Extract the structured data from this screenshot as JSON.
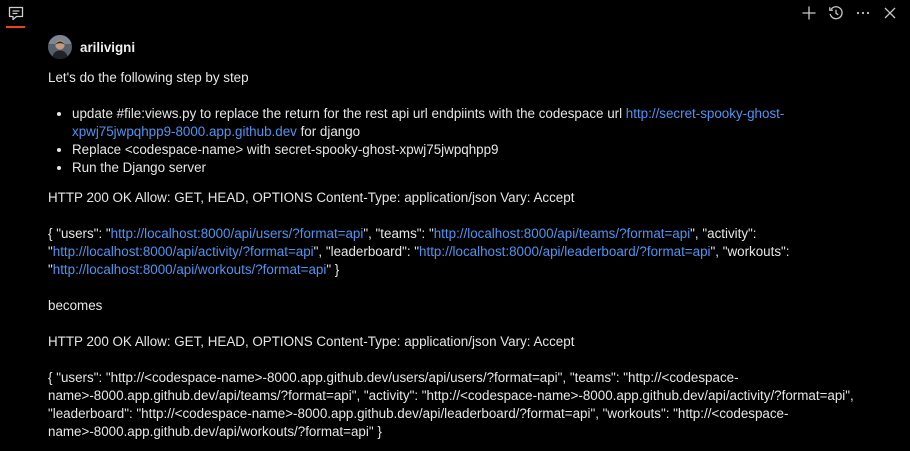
{
  "colors": {
    "background": "#000000",
    "text": "#e6e6e6",
    "link": "#4e94f0",
    "accent": "#e8412f"
  },
  "toolbar": {
    "tab_icon": "chat-icon",
    "actions": [
      {
        "icon": "plus-icon"
      },
      {
        "icon": "history-icon"
      },
      {
        "icon": "more-icon"
      },
      {
        "icon": "close-icon"
      }
    ]
  },
  "message": {
    "username": "arilivigni",
    "intro": "Let's do the following step by step",
    "bullet1_pre": "update #file:views.py to replace the return for the rest api url endpiints with the codespace url ",
    "bullet1_link": "http://secret-spooky-ghost-xpwj75jwpqhpp9-8000.app.github.dev",
    "bullet1_post": " for django",
    "bullet2": "Replace <codespace-name> with secret-spooky-ghost-xpwj75jwpqhpp9",
    "bullet3": "Run the Django server",
    "http_line": "HTTP 200 OK Allow: GET, HEAD, OPTIONS Content-Type: application/json Vary: Accept",
    "json1": {
      "t1": "{ \"users\": \"",
      "l1": "http://localhost:8000/api/users/?format=api",
      "t2": "\", \"teams\": \"",
      "l2": "http://localhost:8000/api/teams/?format=api",
      "t3": "\", \"activity\": \"",
      "l3": "http://localhost:8000/api/activity/?format=api",
      "t4": "\", \"leaderboard\": \"",
      "l4": "http://localhost:8000/api/leaderboard/?format=api",
      "t5": "\", \"workouts\": \"",
      "l5": "http://localhost:8000/api/workouts/?format=api",
      "t6": "\" }"
    },
    "becomes": "becomes",
    "http_line2": "HTTP 200 OK Allow: GET, HEAD, OPTIONS Content-Type: application/json Vary: Accept",
    "json2": "{ \"users\": \"http://<codespace-name>-8000.app.github.dev/users/api/users/?format=api\", \"teams\": \"http://<codespace-name>-8000.app.github.dev/api/teams/?format=api\", \"activity\": \"http://<codespace-name>-8000.app.github.dev/api/activity/?format=api\", \"leaderboard\": \"http://<codespace-name>-8000.app.github.dev/api/leaderboard/?format=api\", \"workouts\": \"http://<codespace-name>-8000.app.github.dev/api/workouts/?format=api\" }"
  }
}
